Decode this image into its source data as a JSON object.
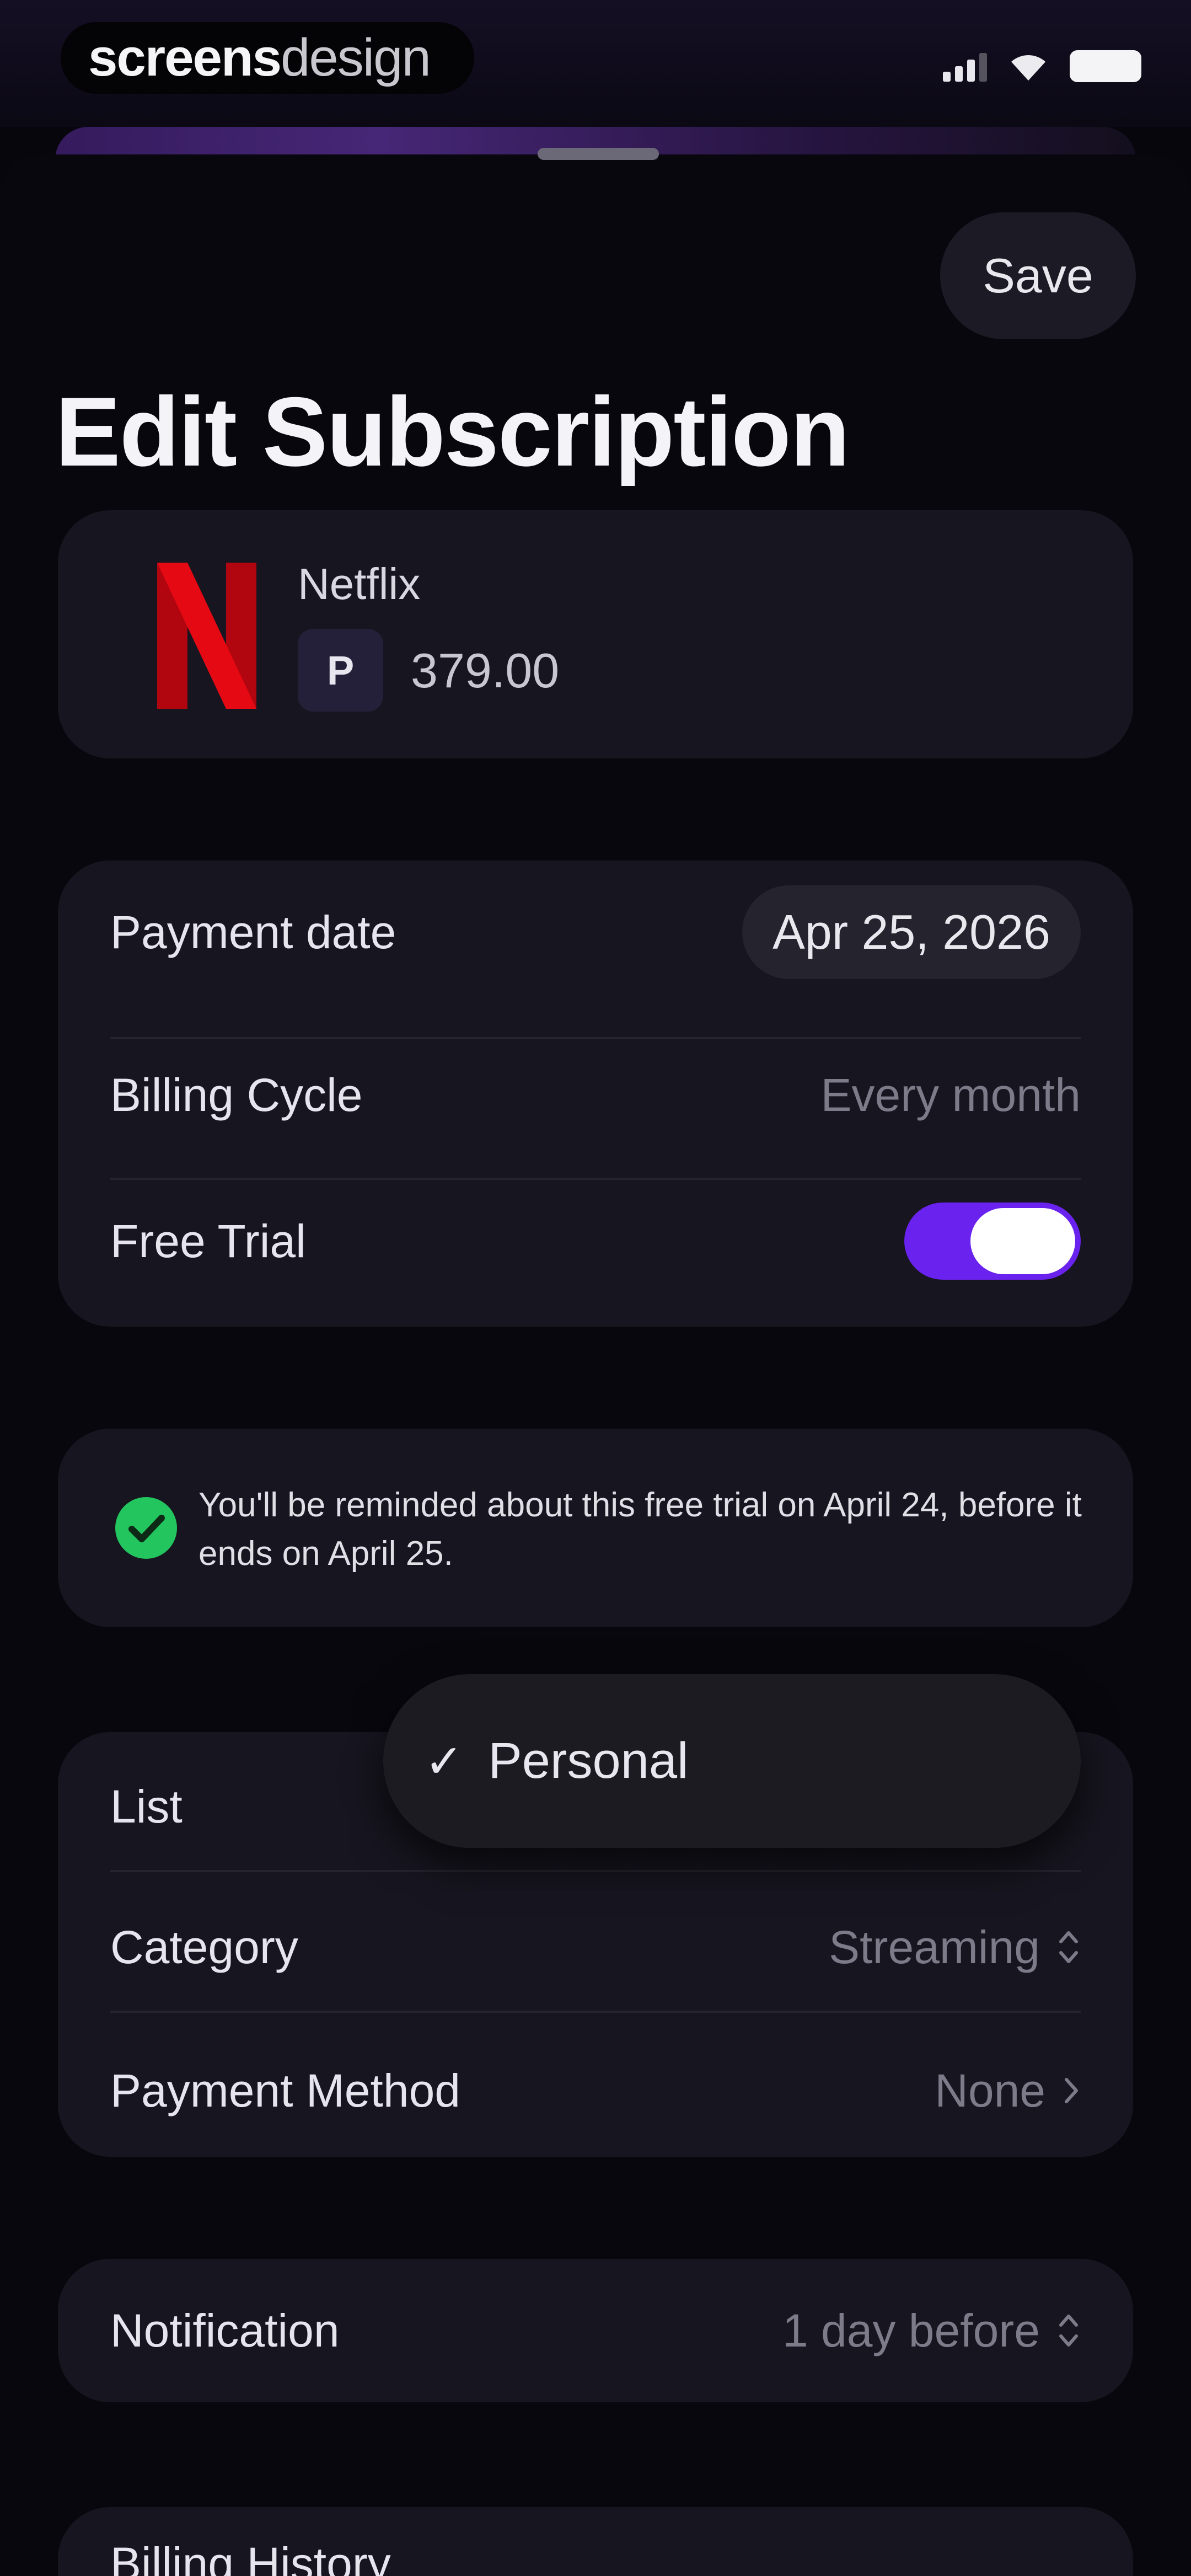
{
  "brand": {
    "bold": "screens",
    "light": "design"
  },
  "header": {
    "save_label": "Save",
    "title": "Edit Subscription"
  },
  "service": {
    "name": "Netflix",
    "currency_symbol": "P",
    "price": "379.00",
    "logo_color": "#e50914"
  },
  "details": {
    "payment_date_label": "Payment date",
    "payment_date_value": "Apr 25, 2026",
    "billing_cycle_label": "Billing Cycle",
    "billing_cycle_value": "Every month",
    "free_trial_label": "Free Trial",
    "free_trial_on": true,
    "toggle_color": "#6a22ee"
  },
  "reminder": {
    "text": "You'll be reminded about this free trial on April 24, before it ends on April 25.",
    "icon": "check-circle-icon",
    "icon_color": "#22c55e"
  },
  "organize": {
    "list_label": "List",
    "category_label": "Category",
    "category_value": "Streaming",
    "payment_method_label": "Payment Method",
    "payment_method_value": "None"
  },
  "popover": {
    "check": "✓",
    "option": "Personal"
  },
  "notification": {
    "label": "Notification",
    "value": "1 day before"
  },
  "history": {
    "label": "Billing History"
  }
}
